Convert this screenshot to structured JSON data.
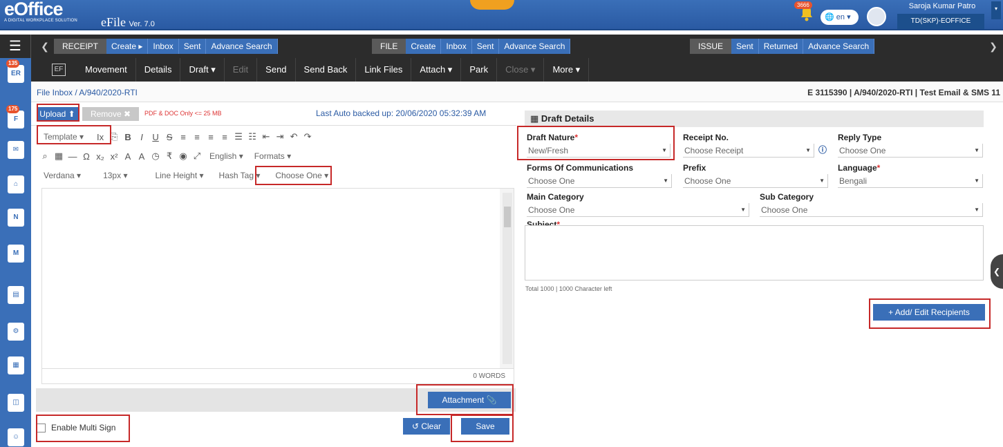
{
  "header": {
    "logo_text": "eOffice",
    "logo_tagline": "A DIGITAL WORKPLACE SOLUTION",
    "app_name": "eFile",
    "app_version": "Ver. 7.0",
    "notification_count": "3666",
    "language": "en",
    "user_name": "Saroja Kumar Patro",
    "user_role": "TD(SKP)-EOFFICE",
    "accent_color": "#3a6fb8"
  },
  "nav": {
    "receipt": {
      "label": "RECEIPT",
      "items": [
        "Create ▸",
        "Inbox",
        "Sent",
        "Advance Search"
      ]
    },
    "file": {
      "label": "FILE",
      "items": [
        "Create",
        "Inbox",
        "Sent",
        "Advance Search"
      ]
    },
    "issue": {
      "label": "ISSUE",
      "items": [
        "Sent",
        "Returned",
        "Advance Search"
      ]
    }
  },
  "toolbar": {
    "ef_label": "EF",
    "items": [
      "Movement",
      "Details",
      "Draft ▾",
      "Edit",
      "Send",
      "Send Back",
      "Link Files",
      "Attach ▾",
      "Park",
      "Close ▾",
      "More ▾"
    ]
  },
  "sidebar": {
    "badges": [
      "135",
      "175"
    ]
  },
  "breadcrumb": {
    "path": "File Inbox  /  A/940/2020-RTI",
    "right": "E  3115390  |  A/940/2020-RTI  |  Test Email & SMS 11"
  },
  "editor": {
    "upload": "Upload ⬆",
    "remove": "Remove ✖",
    "pdf_note": "PDF & DOC Only <= 25 MB",
    "autobackup": "Last Auto backed up: 20/06/2020 05:32:39 AM",
    "template": "Template",
    "language": "English",
    "formats": "Formats",
    "font": "Verdana",
    "size": "13px",
    "line_height": "Line Height",
    "hash_tag": "Hash Tag",
    "choose_one": "Choose One",
    "word_count": "0 WORDS",
    "attachment": "Attachment",
    "enable_multi_sign": "Enable Multi Sign",
    "clear": "Clear",
    "save": "Save"
  },
  "draft": {
    "title": "Draft Details",
    "draft_nature": {
      "label": "Draft Nature",
      "value": "New/Fresh"
    },
    "receipt_no": {
      "label": "Receipt No.",
      "value": "Choose Receipt"
    },
    "reply_type": {
      "label": "Reply Type",
      "value": "Choose One"
    },
    "forms": {
      "label": "Forms Of Communications",
      "value": "Choose One"
    },
    "prefix": {
      "label": "Prefix",
      "value": "Choose One"
    },
    "language": {
      "label": "Language",
      "value": "Bengali"
    },
    "main_category": {
      "label": "Main Category",
      "value": "Choose One"
    },
    "sub_category": {
      "label": "Sub Category",
      "value": "Choose One"
    },
    "subject": {
      "label": "Subject"
    },
    "char_left": "Total 1000 | 1000 Character left",
    "recipients_button": "+ Add/ Edit Recipients"
  }
}
